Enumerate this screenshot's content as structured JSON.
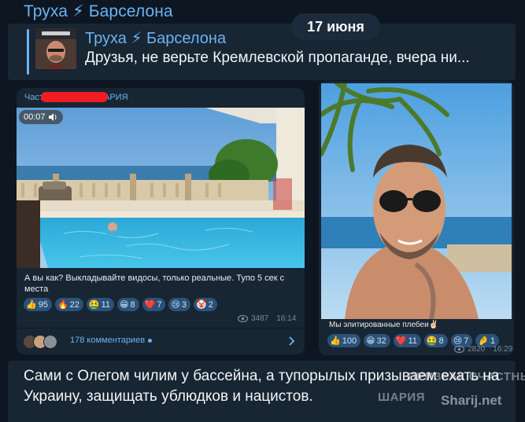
{
  "channel": {
    "title": "Труха ⚡ Барселона"
  },
  "date_pill": "17 июня",
  "forwarded": {
    "title": "Труха ⚡ Барселона",
    "text": "Друзья, не верьте Кремлевской пропаганде, вчера ни..."
  },
  "post_left": {
    "source_prefix": "Част",
    "source_suffix": "АРИЯ",
    "video_duration": "00:07",
    "caption": "А вы как? Выкладывайте видосы, только реальные. Тупо 5 сек с места",
    "reactions": [
      {
        "emoji": "👍",
        "count": "95"
      },
      {
        "emoji": "🔥",
        "count": "22"
      },
      {
        "emoji": "🤮",
        "count": "11"
      },
      {
        "emoji": "😁",
        "count": "8"
      },
      {
        "emoji": "❤️",
        "count": "7"
      },
      {
        "emoji": "😢",
        "count": "3"
      },
      {
        "emoji": "🤡",
        "count": "2"
      }
    ],
    "views": "3487",
    "time": "16:14",
    "comments_label": "178 комментариев"
  },
  "post_right": {
    "caption": "Мы элитированные плебеи✌🏻",
    "reactions": [
      {
        "emoji": "👍",
        "count": "100"
      },
      {
        "emoji": "😁",
        "count": "32"
      },
      {
        "emoji": "❤️",
        "count": "11"
      },
      {
        "emoji": "🤮",
        "count": "8"
      },
      {
        "emoji": "😢",
        "count": "7"
      },
      {
        "emoji": "🤌",
        "count": "1"
      }
    ],
    "views": "2820",
    "time": "16:29"
  },
  "bottom_text": "Сами с Олегом чилим у бассейна, а тупорылых призываем ехать на Украину, защищать ублюдков и нацистов.",
  "watermark": {
    "line1": "ПРИЗРАК СЧАСТНЫЙ",
    "line2": "ШАРИЯ",
    "site": "Sharij.net"
  },
  "icons": {
    "eye": "eye-icon",
    "volume": "volume-icon",
    "chevron": "chevron-right-icon"
  },
  "colors": {
    "background": "#0e1621",
    "bubble": "#182533",
    "accent": "#6ab3f3",
    "reaction": "#2b5278",
    "redaction": "#ee1d23"
  }
}
